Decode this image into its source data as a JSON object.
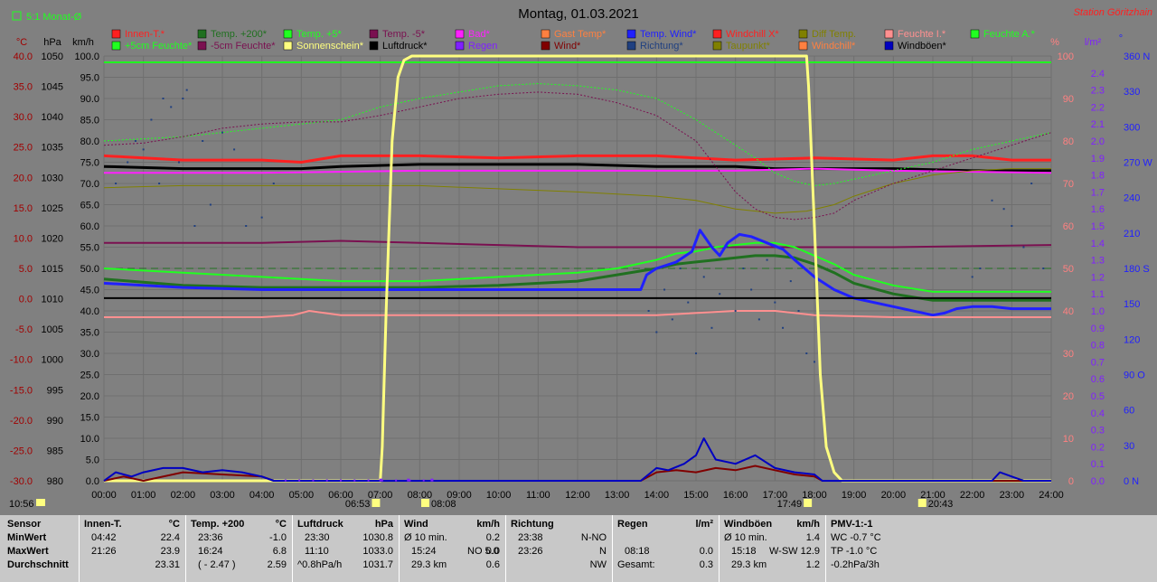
{
  "header": {
    "title": "Montag, 01.03.2021",
    "station": "Station Göritzhain",
    "avg_label": "5:1 Monat-Ø",
    "time_left": "10:56"
  },
  "colors": {
    "background": "#808080",
    "innen": "#ff2020",
    "temp200": "#207020",
    "temp5": "#20ff20",
    "tempm5": "#7a1050",
    "bad": "#ff20ff",
    "gast": "#ff8040",
    "tempwind": "#2020ff",
    "windchill": "#ff2020",
    "diff": "#808000",
    "feuchtei": "#ff9090",
    "feuchtea": "#20ff20",
    "sonne": "#ffff80",
    "luftdruck": "#000000",
    "regen": "#8020ff",
    "wind": "#800000",
    "richtung": "#204080",
    "windboen": "#0000c0"
  },
  "legend": {
    "row1": [
      "Innen-T.*",
      "Temp. +200*",
      "Temp. +5*",
      "Temp. -5*",
      "Bad*",
      "Gast Temp*",
      "Temp. Wind*",
      "Windchill X*",
      "Diff Temp.",
      "Feuchte I.*",
      "Feuchte A.*"
    ],
    "row2": [
      "+5cm Feuchte*",
      "-5cm Feuchte*",
      "Sonnenschein*",
      "Luftdruck*",
      "Regen",
      "Wind*",
      "Richtung*",
      "Taupunkt*",
      "Windchill*",
      "Windböen*"
    ]
  },
  "axes": {
    "celsius_unit": "°C",
    "hpa_unit": "hPa",
    "kmh_unit": "km/h",
    "percent_unit": "%",
    "rain_unit": "l/m²",
    "dir_unit": "°",
    "celsius_ticks": [
      "40.0",
      "35.0",
      "30.0",
      "25.0",
      "20.0",
      "15.0",
      "10.0",
      "5.0",
      "0.0",
      "-5.0",
      "-10.0",
      "-15.0",
      "-20.0",
      "-25.0",
      "-30.0"
    ],
    "hpa_ticks": [
      "1050",
      "1045",
      "1040",
      "1035",
      "1030",
      "1025",
      "1020",
      "1015",
      "1010",
      "1005",
      "1000",
      "995",
      "990",
      "985",
      "980"
    ],
    "kmh_ticks": [
      "100.0",
      "95.0",
      "90.0",
      "85.0",
      "80.0",
      "75.0",
      "70.0",
      "65.0",
      "60.0",
      "55.0",
      "50.0",
      "45.0",
      "40.0",
      "35.0",
      "30.0",
      "25.0",
      "20.0",
      "15.0",
      "10.0",
      "5.0",
      "0.0"
    ],
    "percent_ticks": [
      "100",
      "90",
      "80",
      "70",
      "60",
      "50",
      "40",
      "30",
      "20",
      "10",
      "0"
    ],
    "rain_ticks": [
      "2.4",
      "2.3",
      "2.2",
      "2.1",
      "2.0",
      "1.9",
      "1.8",
      "1.7",
      "1.6",
      "1.5",
      "1.4",
      "1.3",
      "1.2",
      "1.1",
      "1.0",
      "0.9",
      "0.8",
      "0.7",
      "0.6",
      "0.5",
      "0.4",
      "0.3",
      "0.2",
      "0.1",
      "0.0"
    ],
    "dir_ticks": [
      "360 N",
      "330",
      "300",
      "270 W",
      "240",
      "210",
      "180 S",
      "150",
      "120",
      "90 O",
      "60",
      "30",
      "0 N"
    ],
    "time_ticks": [
      "00:00",
      "01:00",
      "02:00",
      "03:00",
      "04:00",
      "05:00",
      "06:00",
      "07:00",
      "08:00",
      "09:00",
      "10:00",
      "11:00",
      "12:00",
      "13:00",
      "14:00",
      "15:00",
      "16:00",
      "17:00",
      "18:00",
      "19:00",
      "20:00",
      "21:00",
      "22:00",
      "23:00",
      "24:00"
    ],
    "markers": [
      {
        "label": "06:53",
        "hour": 6.88
      },
      {
        "label": "08:08",
        "hour": 8.13
      },
      {
        "label": "17:49",
        "hour": 17.82
      },
      {
        "label": "20:43",
        "hour": 20.72
      }
    ]
  },
  "chart_data": {
    "type": "line",
    "title": "Montag, 01.03.2021",
    "x_range": [
      0,
      24
    ],
    "y_range_kmh": [
      0,
      100
    ],
    "grid": true,
    "series": [
      {
        "name": "Innen-T.*",
        "key": "innen",
        "width": 3,
        "x": [
          0,
          2,
          4,
          5,
          6,
          8,
          10,
          12,
          14,
          16,
          18,
          20,
          21,
          22,
          23,
          24
        ],
        "y": [
          76.5,
          75.5,
          75.5,
          75,
          76.5,
          76.5,
          76,
          76.5,
          76.5,
          75.5,
          76,
          75.5,
          76.5,
          76.5,
          75.5,
          75.5
        ]
      },
      {
        "name": "Luftdruck*",
        "key": "luftdruck",
        "width": 3,
        "x": [
          0,
          2,
          3,
          4,
          5,
          6,
          8,
          10,
          12,
          14,
          16,
          17,
          18,
          20,
          22,
          24
        ],
        "y": [
          74,
          73.5,
          73.5,
          73.5,
          73.5,
          74,
          74.5,
          74.5,
          74.5,
          74,
          74,
          73.5,
          73.5,
          73.5,
          73,
          73
        ]
      },
      {
        "name": "Bad*",
        "key": "bad",
        "width": 2,
        "x": [
          0,
          4,
          8,
          12,
          16,
          18,
          20,
          24
        ],
        "y": [
          72.5,
          72.5,
          73,
          73,
          73,
          73.5,
          73,
          72.5
        ]
      },
      {
        "name": "Diff Temp.",
        "key": "diff",
        "width": 1,
        "x": [
          0,
          2,
          4,
          8,
          12,
          14,
          15,
          16,
          17,
          17.8,
          18.5,
          19,
          20,
          21,
          22,
          23,
          24
        ],
        "y": [
          69,
          69.5,
          69.5,
          69.5,
          68,
          67,
          66,
          64,
          63,
          63.5,
          65,
          67,
          70,
          72,
          73,
          73.5,
          73.5
        ]
      },
      {
        "name": "Temp. -5*",
        "key": "tempm5",
        "width": 2,
        "x": [
          0,
          2,
          4,
          6,
          8,
          12,
          14,
          16,
          18,
          20,
          24
        ],
        "y": [
          56,
          56,
          56,
          56.5,
          56,
          55,
          55,
          55,
          55,
          55,
          55.5
        ]
      },
      {
        "name": "Temp. +5*",
        "key": "temp5",
        "width": 2,
        "x": [
          0,
          2,
          4,
          6,
          8,
          10,
          12,
          13,
          14,
          14.5,
          15,
          15.5,
          16,
          16.5,
          17,
          17.5,
          18,
          18.5,
          19,
          20,
          21,
          22,
          23,
          24
        ],
        "y": [
          50,
          49,
          48,
          47,
          47,
          48,
          49,
          50,
          52,
          53.5,
          54,
          55,
          55.5,
          56,
          56,
          55,
          53,
          51,
          48.5,
          46,
          44.5,
          44.5,
          44.5,
          44.5
        ]
      },
      {
        "name": "Temp. +200*",
        "key": "temp200",
        "width": 3,
        "x": [
          0,
          2,
          4,
          6,
          8,
          10,
          12,
          13,
          14,
          14.5,
          15,
          15.5,
          16,
          16.5,
          17,
          17.5,
          18,
          18.5,
          19,
          20,
          21,
          22,
          23,
          24
        ],
        "y": [
          47.5,
          46,
          45.5,
          45.5,
          45.5,
          46,
          47,
          48.5,
          50,
          51,
          51.5,
          52,
          52.5,
          53,
          53,
          52.5,
          51,
          49,
          46.5,
          44,
          42.5,
          42.5,
          42.5,
          42.5
        ]
      },
      {
        "name": "Temp. Wind*",
        "key": "tempwind",
        "width": 3,
        "x": [
          0,
          2,
          4,
          6,
          8,
          10,
          12,
          13,
          13.6,
          13.75,
          14,
          14.5,
          14.9,
          15.1,
          15.4,
          15.6,
          15.8,
          16.1,
          16.4,
          16.8,
          17.2,
          17.5,
          18,
          18.5,
          19,
          20,
          21,
          21.3,
          21.6,
          22,
          22.5,
          23,
          24
        ],
        "y": [
          46.5,
          45.5,
          45,
          45,
          45,
          45,
          45,
          45,
          45,
          48.5,
          50,
          51.5,
          54,
          59,
          55,
          53,
          56,
          58,
          57.5,
          56,
          54.5,
          52,
          48,
          45,
          43,
          41,
          39,
          39.5,
          40.5,
          41,
          41,
          40.5,
          40.5
        ]
      },
      {
        "name": "Luftdruck* (Ø)",
        "key": "luftdruck",
        "width": 2,
        "x": [
          0,
          24
        ],
        "y": [
          43,
          43
        ]
      },
      {
        "name": "Feuchte I.*",
        "key": "feuchtei",
        "width": 2,
        "x": [
          0,
          2,
          4,
          4.8,
          5.2,
          6,
          8,
          10,
          12,
          14,
          16,
          17,
          18,
          20,
          22,
          24
        ],
        "y": [
          38.5,
          38.5,
          38.5,
          39,
          40,
          39,
          39,
          39,
          39,
          39,
          40,
          40,
          39,
          38.5,
          38.5,
          38.5
        ]
      },
      {
        "name": "Feuchte A.*",
        "key": "feuchtea",
        "width": 1,
        "dash": "2,2",
        "x": [
          0,
          1,
          2,
          3,
          4,
          5,
          6,
          7,
          8,
          9,
          10,
          11,
          12,
          13,
          14,
          15,
          15.5,
          16,
          16.5,
          17,
          17.5,
          18,
          18.5,
          19,
          20,
          21,
          22,
          23,
          24
        ],
        "y": [
          80,
          80.5,
          81,
          82,
          83,
          84,
          85,
          88,
          90,
          91.5,
          93,
          93.5,
          93,
          92,
          90,
          85,
          82,
          79,
          76,
          72.5,
          70.5,
          69.5,
          70,
          71,
          73,
          75,
          78,
          80,
          82
        ]
      },
      {
        "name": "+5cm Feuchte*",
        "key": "tempm5",
        "width": 1,
        "dash": "2,2",
        "x": [
          0,
          1,
          2,
          3,
          4,
          5,
          6,
          7,
          8,
          9,
          10,
          11,
          12,
          13,
          14,
          15,
          15.5,
          16,
          16.5,
          17,
          17.5,
          18,
          18.5,
          19,
          20,
          21,
          22,
          23,
          24
        ],
        "y": [
          79,
          79.5,
          81,
          83,
          84,
          84.5,
          84.5,
          86,
          88,
          90,
          91,
          91.5,
          91,
          89,
          86,
          80,
          74,
          68,
          64,
          62,
          61.5,
          62,
          63,
          66,
          70,
          73,
          76,
          79,
          82
        ]
      },
      {
        "name": "Sonnenschein*",
        "key": "sonne",
        "width": 3,
        "x": [
          0,
          7,
          7.05,
          7.15,
          7.3,
          7.45,
          7.6,
          7.8,
          8,
          17.8,
          17.85,
          18,
          18.15,
          18.3,
          18.5,
          18.7,
          24
        ],
        "y": [
          0,
          0,
          8,
          40,
          80,
          95,
          99,
          100,
          100,
          100,
          93,
          60,
          25,
          8,
          2,
          0,
          0
        ]
      },
      {
        "name": "Wind*",
        "key": "wind",
        "width": 2,
        "x": [
          0,
          0.5,
          1,
          2,
          3,
          4,
          4.3,
          13.6,
          14,
          14.5,
          15,
          15.5,
          16,
          16.5,
          17,
          17.5,
          18,
          18.2,
          24
        ],
        "y": [
          0,
          1,
          0,
          2,
          1.5,
          1,
          0,
          0,
          2,
          2.5,
          2,
          3,
          2.5,
          3.5,
          2.5,
          1.5,
          1,
          0,
          0
        ]
      },
      {
        "name": "Windböen*",
        "key": "windboen",
        "width": 2,
        "x": [
          0,
          0.3,
          0.7,
          1,
          1.5,
          2,
          2.5,
          3,
          3.5,
          4,
          4.3,
          13.6,
          14,
          14.3,
          14.7,
          15,
          15.2,
          15.5,
          16,
          16.5,
          17,
          17.5,
          18,
          18.2,
          22.5,
          22.7,
          23,
          23.3,
          24
        ],
        "y": [
          0,
          2,
          1,
          2,
          3,
          3,
          2,
          2.5,
          2,
          1,
          0,
          0,
          3,
          2.5,
          4,
          6,
          10,
          5,
          4,
          6,
          3,
          2,
          1.5,
          0,
          0,
          2,
          1,
          0,
          0
        ]
      },
      {
        "name": "Richtung*",
        "key": "richtung",
        "width": 1,
        "scatter": true,
        "x": [
          0.3,
          0.6,
          0.8,
          1.0,
          1.2,
          1.4,
          1.5,
          1.7,
          1.9,
          2.0,
          2.1,
          2.3,
          2.5,
          2.7,
          3.0,
          3.3,
          3.6,
          4.0,
          4.3,
          13.8,
          14.0,
          14.2,
          14.4,
          14.6,
          14.8,
          15.0,
          15.2,
          15.4,
          15.6,
          15.8,
          16.0,
          16.2,
          16.4,
          16.6,
          16.8,
          17.0,
          17.2,
          17.4,
          17.6,
          17.8,
          18.0,
          22.0,
          22.2,
          22.5,
          22.8,
          23.0,
          23.3,
          23.5,
          23.8
        ],
        "y": [
          70,
          75,
          80,
          78,
          85,
          70,
          90,
          88,
          75,
          90,
          92,
          60,
          80,
          65,
          82,
          78,
          60,
          62,
          70,
          40,
          35,
          45,
          38,
          50,
          42,
          30,
          48,
          36,
          44,
          55,
          40,
          50,
          45,
          38,
          52,
          42,
          36,
          47,
          40,
          30,
          28,
          48,
          50,
          66,
          64,
          60,
          55,
          70,
          50
        ]
      }
    ]
  },
  "stats": {
    "headers": {
      "sensor": "Sensor",
      "innen": "Innen-T.",
      "innen_unit": "°C",
      "temp": "Temp. +200",
      "temp_unit": "°C",
      "luft": "Luftdruck",
      "luft_unit": "hPa",
      "wind": "Wind",
      "wind_unit": "km/h",
      "richtung": "Richtung",
      "regen": "Regen",
      "regen_unit": "l/m²",
      "boen": "Windböen",
      "boen_unit": "km/h",
      "pmv": "PMV-1:-1"
    },
    "labels": {
      "min": "MinWert",
      "max": "MaxWert",
      "avg": "Durchschnitt"
    },
    "innen": {
      "min_t": "04:42",
      "min_v": "22.4",
      "max_t": "21:26",
      "max_v": "23.9",
      "avg_v": "23.31"
    },
    "temp": {
      "min_t": "23:36",
      "min_v": "-1.0",
      "max_t": "16:24",
      "max_v": "6.8",
      "avg_t": "( - 2.47 )",
      "avg_v": "2.59"
    },
    "luft": {
      "min_t": "23:30",
      "min_v": "1030.8",
      "max_t": "11:10",
      "max_v": "1033.0",
      "avg_t": "^0.8hPa/h",
      "avg_v": "1031.7"
    },
    "wind": {
      "min_t": "Ø 10 min.",
      "min_v": "0.2",
      "max_t": "15:24",
      "max_d": "NO 5.0",
      "max_v": "0.0",
      "avg_t": "29.3 km",
      "avg_v": "0.6"
    },
    "richtung": {
      "min_t": "23:38",
      "min_v": "N-NO",
      "max_t": "23:26",
      "max_v": "N",
      "avg_v": "NW"
    },
    "regen": {
      "max_t": "08:18",
      "max_v": "0.0",
      "avg_t": "Gesamt:",
      "avg_v": "0.3"
    },
    "boen": {
      "min_t": "Ø 10 min.",
      "min_v": "1.4",
      "max_t": "15:18",
      "max_d": "W-SW 12.9",
      "avg_t": "29.3 km",
      "avg_v": "1.2"
    },
    "pmv": {
      "min": "WC -0.7 °C",
      "max": "TP -1.0 °C",
      "avg": "-0.2hPa/3h"
    }
  }
}
